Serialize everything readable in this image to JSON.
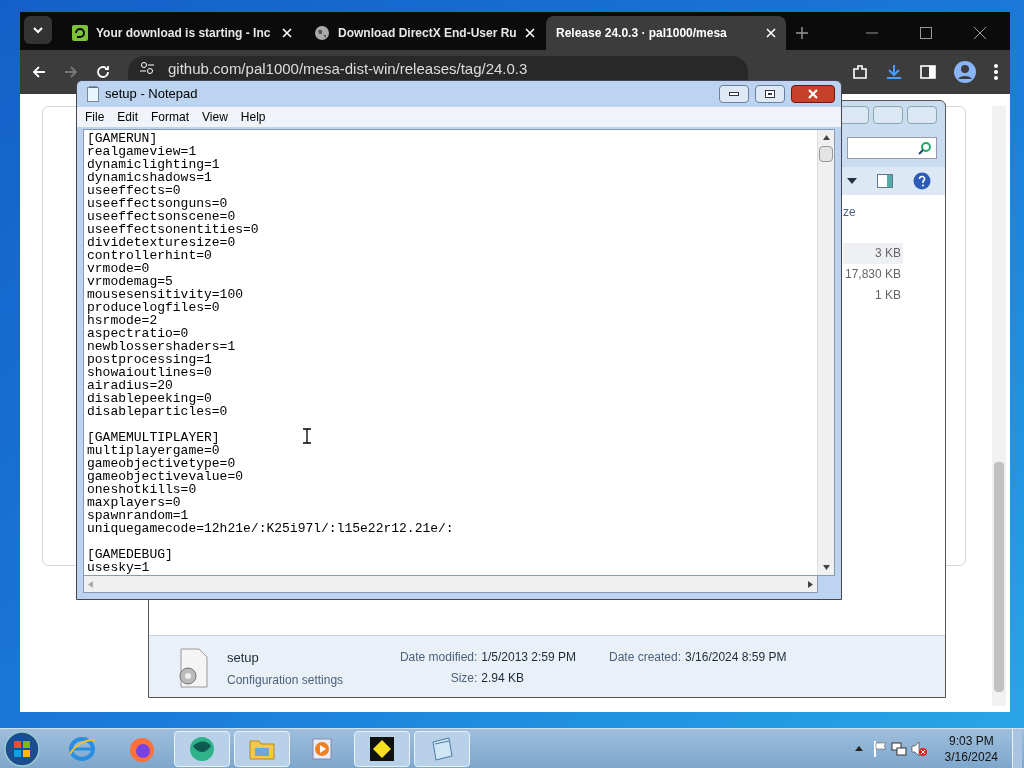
{
  "browser": {
    "tabs": [
      {
        "title": "Your download is starting - Inc",
        "selected": false,
        "kind": "download"
      },
      {
        "title": "Download DirectX End-User Ru",
        "selected": false,
        "kind": "globe"
      },
      {
        "title": "Release 24.0.3 · pal1000/mesa",
        "selected": true,
        "kind": "plain"
      }
    ],
    "url": "github.com/pal1000/mesa-dist-win/releases/tag/24.0.3"
  },
  "explorer": {
    "column_header": "ze",
    "sizes": [
      "3 KB",
      "17,830 KB",
      "1 KB"
    ],
    "details": {
      "name": "setup",
      "type": "Configuration settings",
      "modified_label": "Date modified:",
      "modified": "1/5/2013 2:59 PM",
      "size_label": "Size:",
      "size": "2.94 KB",
      "created_label": "Date created:",
      "created": "3/16/2024 8:59 PM"
    }
  },
  "notepad": {
    "title": "setup - Notepad",
    "menu": [
      "File",
      "Edit",
      "Format",
      "View",
      "Help"
    ],
    "sections": [
      {
        "lines": [
          "[GAMERUN]",
          "realgameview=1",
          "dynamiclighting=1",
          "dynamicshadows=1",
          "useeffects=0",
          "useeffectsonguns=0",
          "useeffectsonscene=0",
          "useeffectsonentities=0",
          "dividetexturesize=0",
          "controllerhint=0",
          "vrmode=0",
          "vrmodemag=5",
          "mousesensitivity=100",
          "producelogfiles=0",
          "hsrmode=2",
          "aspectratio=0",
          "newblossershaders=1",
          "postprocessing=1",
          "showaioutlines=0",
          "airadius=20",
          "disablepeeking=0",
          "disableparticles=0"
        ]
      },
      {
        "lines": [
          "[GAMEMULTIPLAYER]",
          "multiplayergame=0",
          "gameobjectivetype=0",
          "gameobjectivevalue=0",
          "oneshotkills=0",
          "maxplayers=0",
          "spawnrandom=1",
          "uniquegamecode=12h21e/:K25i97l/:l15e22r12.21e/:"
        ]
      },
      {
        "lines": [
          "[GAMEDEBUG]",
          "usesky=1"
        ]
      }
    ]
  },
  "taskbar": {
    "items": [
      {
        "kind": "ie",
        "running": false
      },
      {
        "kind": "firefox",
        "running": false
      },
      {
        "kind": "globe",
        "running": true
      },
      {
        "kind": "folder",
        "running": true
      },
      {
        "kind": "media",
        "running": false
      },
      {
        "kind": "yellow",
        "running": true
      },
      {
        "kind": "notepad",
        "running": true
      }
    ],
    "time": "9:03 PM",
    "date": "3/16/2024"
  }
}
